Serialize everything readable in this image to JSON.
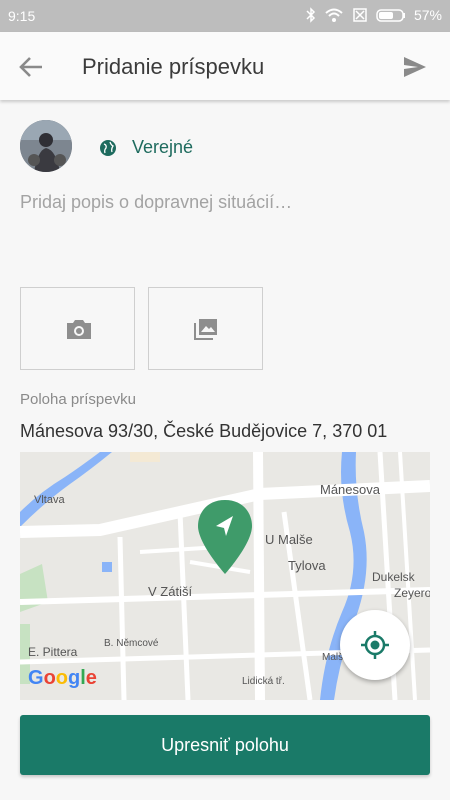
{
  "status": {
    "time": "9:15",
    "battery": "57%"
  },
  "header": {
    "title": "Pridanie príspevku",
    "back_icon": "arrow-back-icon",
    "send_icon": "send-icon"
  },
  "post": {
    "visibility_label": "Verejné",
    "visibility_icon": "globe-icon",
    "description_placeholder": "Pridaj popis o dopravnej situácií…",
    "media_buttons": [
      "camera-icon",
      "gallery-icon"
    ]
  },
  "location": {
    "label": "Poloha príspevku",
    "address": "Mánesova 93/30, České Budějovice 7, 370 01"
  },
  "map": {
    "streets": [
      "Vltava",
      "Mánesova",
      "U Malše",
      "Tylova",
      "V Zátiší",
      "B. Němcové",
      "E. Pittera",
      "Lidická tř.",
      "Malše",
      "Dukelsk",
      "Zeyerova"
    ],
    "attribution": "Google",
    "accent_color": "#3f9b6a"
  },
  "actions": {
    "refine_label": "Upresniť polohu"
  },
  "colors": {
    "primary": "#1a7a68",
    "river": "#8ab4f8"
  }
}
